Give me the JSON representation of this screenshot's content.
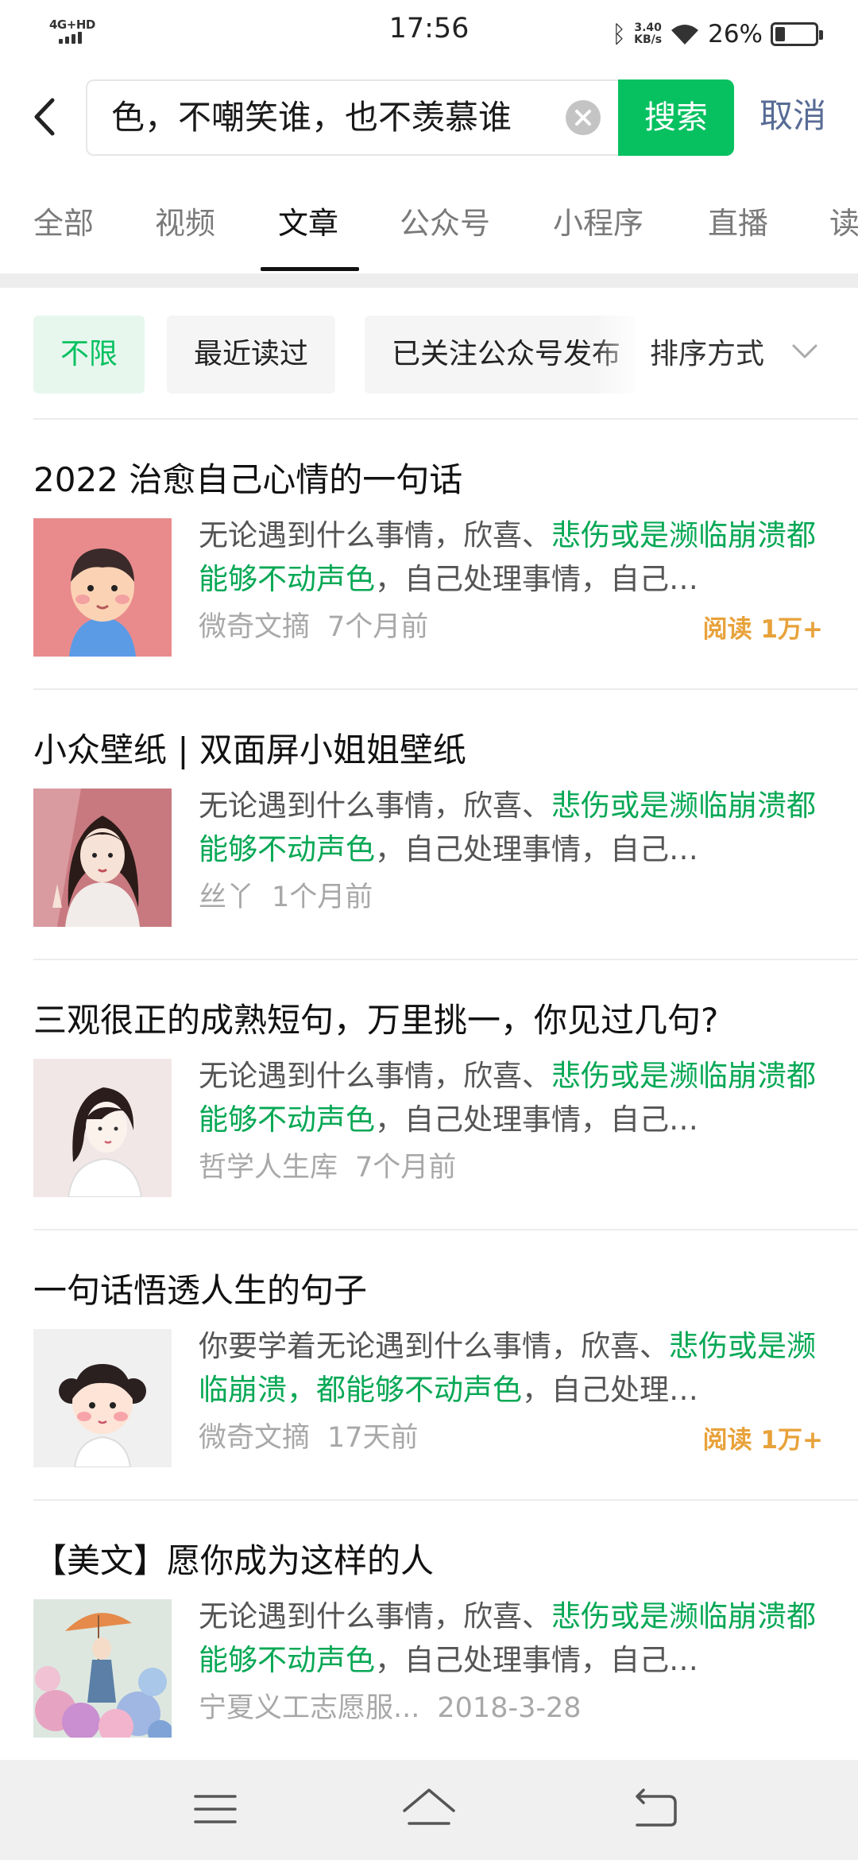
{
  "status_bar": {
    "network": "4G+HD",
    "time": "17:56",
    "speed_value": "3.40",
    "speed_unit": "KB/s",
    "battery": "26%",
    "battery_level": 0.26
  },
  "search": {
    "query": "色，不嘲笑谁，也不羡慕谁",
    "search_label": "搜索",
    "cancel_label": "取消"
  },
  "tabs": [
    {
      "label": "全部",
      "active": false
    },
    {
      "label": "视频",
      "active": false
    },
    {
      "label": "文章",
      "active": true
    },
    {
      "label": "公众号",
      "active": false
    },
    {
      "label": "小程序",
      "active": false
    },
    {
      "label": "直播",
      "active": false
    },
    {
      "label": "读",
      "active": false
    }
  ],
  "filters": {
    "chips": [
      "不限",
      "最近读过",
      "已关注公众号发布"
    ],
    "sort_label": "排序方式"
  },
  "results": [
    {
      "title": "2022 治愈自己心情的一句话",
      "snippet_plain_1": "无论遇到什么事情，欣喜、",
      "snippet_hl": "悲伤或是濒临崩溃都能够不动声色",
      "snippet_plain_2": "，自己处理事情，自己…",
      "source": "微奇文摘",
      "date": "7个月前",
      "reads": "阅读 1万+"
    },
    {
      "title": "小众壁纸 | 双面屏小姐姐壁纸",
      "snippet_plain_1": "无论遇到什么事情，欣喜、",
      "snippet_hl": "悲伤或是濒临崩溃都能够不动声色",
      "snippet_plain_2": "，自己处理事情，自己…",
      "source": "丝丫",
      "date": "1个月前",
      "reads": ""
    },
    {
      "title": "三观很正的成熟短句，万里挑一，你见过几句?",
      "snippet_plain_1": "无论遇到什么事情，欣喜、",
      "snippet_hl": "悲伤或是濒临崩溃都能够不动声色",
      "snippet_plain_2": "，自己处理事情，自己…",
      "source": "哲学人生库",
      "date": "7个月前",
      "reads": ""
    },
    {
      "title": "一句话悟透人生的句子",
      "snippet_plain_1": "你要学着无论遇到什么事情，欣喜、",
      "snippet_hl": "悲伤或是濒临崩溃，都能够不动声色",
      "snippet_plain_2": "，自己处理…",
      "source": "微奇文摘",
      "date": "17天前",
      "reads": "阅读 1万+"
    },
    {
      "title": "【美文】愿你成为这样的人",
      "snippet_plain_1": "无论遇到什么事情，欣喜、",
      "snippet_hl": "悲伤或是濒临崩溃都能够不动声色",
      "snippet_plain_2": "，自己处理事情，自己…",
      "source": "宁夏义工志愿服...",
      "date": "2018-3-28",
      "reads": ""
    }
  ],
  "colors": {
    "accent_green": "#07c160",
    "highlight_green": "#07a855",
    "link_blue": "#576b95",
    "reads_orange": "#e8a23a"
  },
  "icons": {
    "back": "chevron-left-icon",
    "clear": "close-circle-icon",
    "sort": "chevron-down-icon",
    "nav_menu": "menu-icon",
    "nav_home": "home-icon",
    "nav_back": "back-arrow-icon"
  }
}
